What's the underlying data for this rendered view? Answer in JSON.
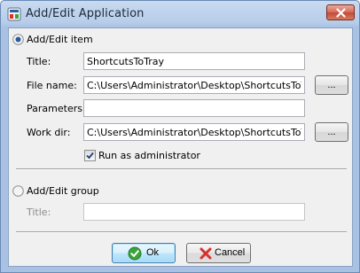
{
  "window": {
    "title": "Add/Edit Application"
  },
  "item_section": {
    "radio_label": "Add/Edit item",
    "selected": true,
    "title_label": "Title:",
    "title_value": "ShortcutsToTray",
    "file_name_label": "File name:",
    "file_name_value": "C:\\Users\\Administrator\\Desktop\\ShortcutsToTray\\S",
    "parameters_label": "Parameters:",
    "parameters_value": "",
    "work_dir_label": "Work dir:",
    "work_dir_value": "C:\\Users\\Administrator\\Desktop\\ShortcutsToTray\\S",
    "browse_label": "...",
    "run_as_admin_label": "Run as administrator",
    "run_as_admin_checked": true
  },
  "group_section": {
    "radio_label": "Add/Edit group",
    "selected": false,
    "title_label": "Title:",
    "title_value": ""
  },
  "buttons": {
    "ok_label": "Ok",
    "cancel_label": "Cancel"
  },
  "colors": {
    "title_bar": "#b7cde9",
    "client_bg": "#f0f0f0",
    "close": "#c24a36",
    "ok_icon": "#3aa43a",
    "cancel_icon": "#d9302c"
  },
  "icons": [
    "app-icon",
    "close-icon",
    "radio-selected-icon",
    "radio-unselected-icon",
    "checkmark-icon",
    "ok-check-icon",
    "cancel-x-icon"
  ]
}
